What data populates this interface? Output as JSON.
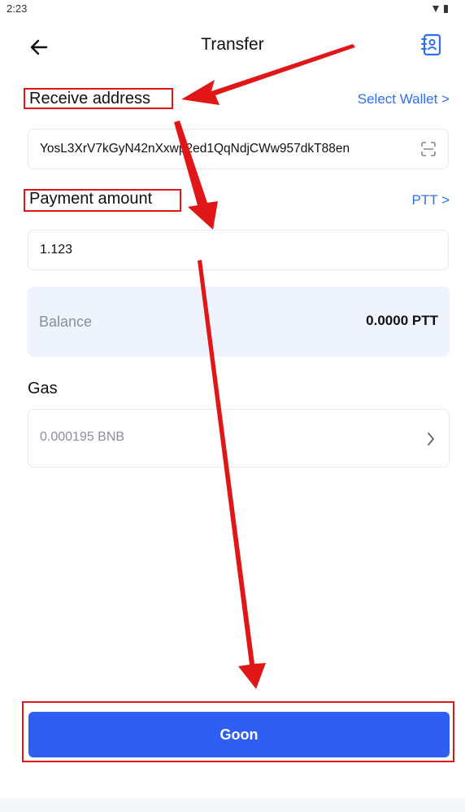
{
  "status_bar": {
    "time": "2:23",
    "icons": [
      "wifi-icon",
      "battery-icon"
    ]
  },
  "header": {
    "title": "Transfer",
    "back_icon": "arrow-left-icon",
    "contacts_icon": "address-book-icon"
  },
  "receive": {
    "label": "Receive address",
    "select_wallet": "Select Wallet >",
    "address": "YosL3XrV7kGyN42nXxwp2ed1QqNdjCWw957dkT88en",
    "scan_icon": "scan-icon"
  },
  "payment": {
    "label": "Payment amount",
    "token_link": "PTT >",
    "amount": "1.123"
  },
  "balance": {
    "label": "Balance",
    "value": "0.0000 PTT"
  },
  "gas": {
    "label": "Gas",
    "value": "0.000195 BNB",
    "chevron_icon": "chevron-right-icon"
  },
  "footer": {
    "button_label": "Goon"
  },
  "colors": {
    "primary": "#2f5ef2",
    "link": "#2f6ff3",
    "annotation": "#e11616",
    "balance_bg": "#eef3fd"
  }
}
